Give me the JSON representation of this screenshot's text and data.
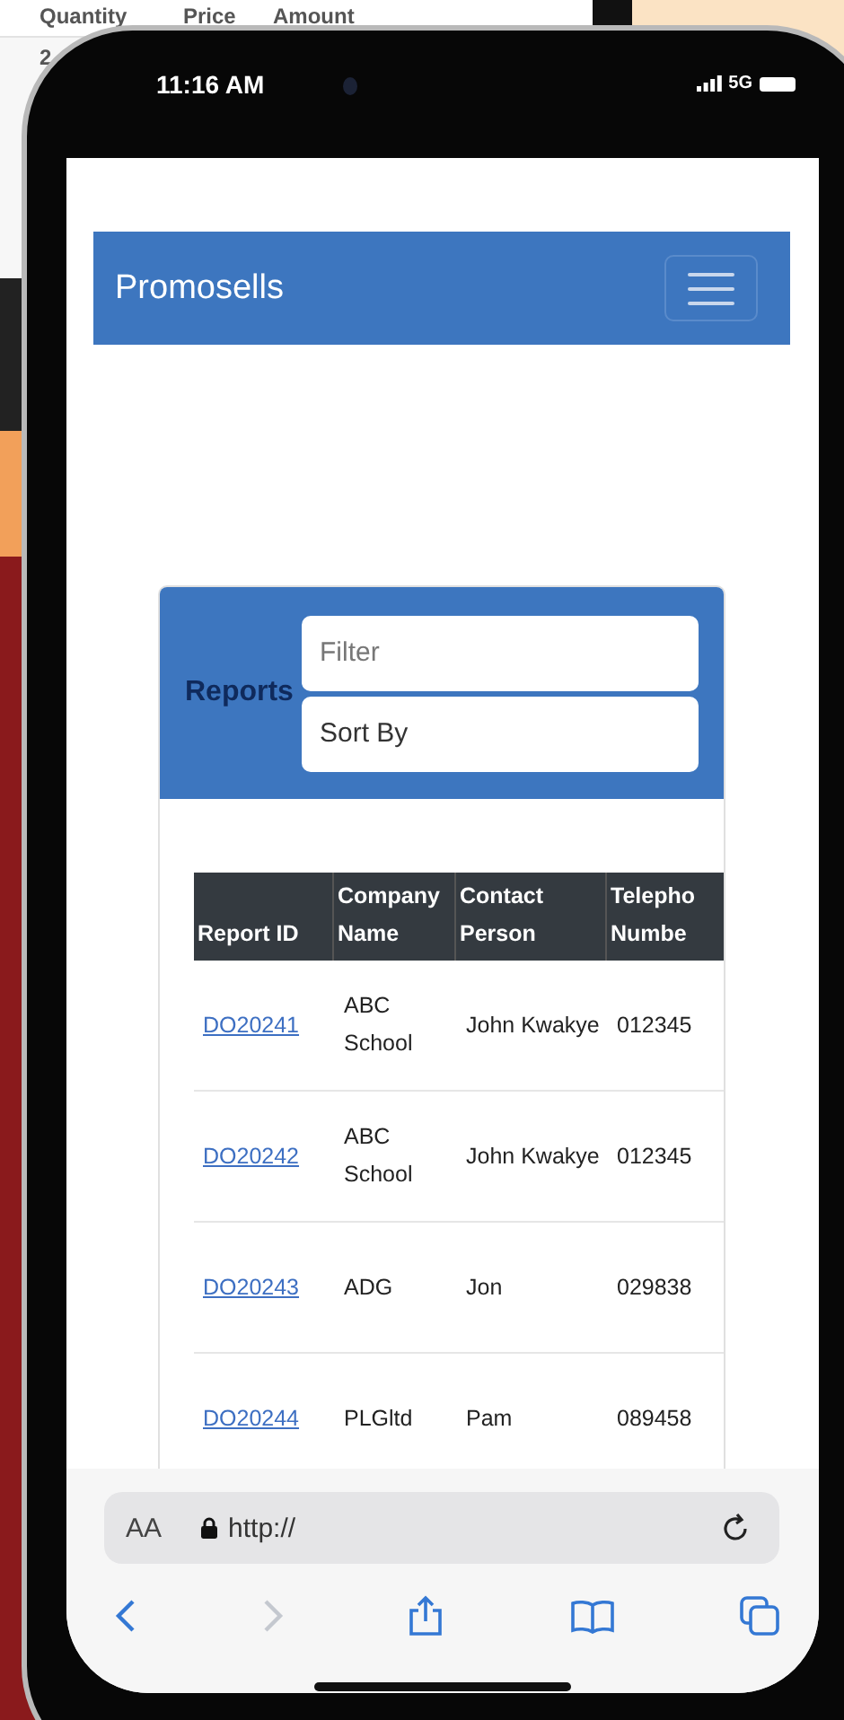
{
  "background_window": {
    "columns": [
      "Quantity",
      "Price",
      "Amount"
    ],
    "cell": "2"
  },
  "status_bar": {
    "time": "11:16 AM",
    "network": "5G"
  },
  "navbar": {
    "brand": "Promosells"
  },
  "reports": {
    "title": "Reports",
    "filter": {
      "placeholder": "Filter"
    },
    "sort": {
      "placeholder": "Sort By"
    },
    "table": {
      "columns": [
        "Report ID",
        "Company Name",
        "Contact Person",
        "Telepho Numbe"
      ],
      "rows": [
        {
          "report_id": "DO20241",
          "company": "ABC School",
          "contact": "John Kwakye",
          "telephone": "012345"
        },
        {
          "report_id": "DO20242",
          "company": "ABC School",
          "contact": "John Kwakye",
          "telephone": "012345"
        },
        {
          "report_id": "DO20243",
          "company": "ADG",
          "contact": "Jon",
          "telephone": "029838"
        },
        {
          "report_id": "DO20244",
          "company": "PLGltd",
          "contact": "Pam",
          "telephone": "089458"
        }
      ]
    }
  },
  "browser": {
    "text_size": "AA",
    "url": "http://"
  }
}
